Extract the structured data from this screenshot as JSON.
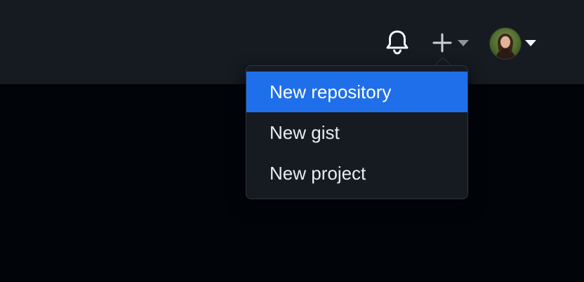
{
  "header": {
    "icons": {
      "notifications": "bell-icon",
      "create": "plus-icon",
      "create_caret": "triangle-down-icon",
      "avatar_caret": "triangle-down-icon"
    }
  },
  "create_menu": {
    "items": [
      {
        "label": "New repository",
        "state": "highlighted"
      },
      {
        "label": "New gist"
      },
      {
        "label": "New project"
      }
    ]
  },
  "colors": {
    "page_bg": "#010409",
    "header_bg": "#161b22",
    "menu_bg": "#161b22",
    "menu_border": "#30363d",
    "highlight": "#1f6feb",
    "text": "#e6edf3"
  }
}
